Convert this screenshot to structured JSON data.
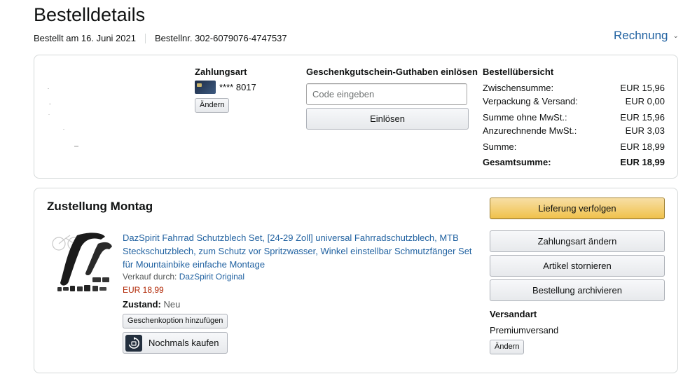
{
  "page": {
    "title": "Bestelldetails",
    "ordered_on": "Bestellt am 16. Juni 2021",
    "order_number": "Bestellnr. 302-6079076-4747537",
    "invoice_label": "Rechnung"
  },
  "payment": {
    "heading": "Zahlungsart",
    "card_masked": "**** 8017",
    "change_label": "Ändern"
  },
  "gift_card": {
    "heading": "Geschenkgutschein-Guthaben einlösen",
    "placeholder": "Code eingeben",
    "redeem_label": "Einlösen"
  },
  "summary": {
    "heading": "Bestellübersicht",
    "rows": [
      {
        "label": "Zwischensumme:",
        "value": "EUR 15,96"
      },
      {
        "label": "Verpackung & Versand:",
        "value": "EUR 0,00"
      },
      {
        "label": "Summe ohne MwSt.:",
        "value": "EUR 15,96"
      },
      {
        "label": "Anzurechnende MwSt.:",
        "value": "EUR 3,03"
      },
      {
        "label": "Summe:",
        "value": "EUR 18,99"
      },
      {
        "label": "Gesamtsumme:",
        "value": "EUR 18,99"
      }
    ]
  },
  "shipment": {
    "heading": "Zustellung Montag",
    "product_title": "DazSpirit Fahrrad Schutzblech Set, [24-29 Zoll] universal Fahrradschutzblech, MTB Steckschutzblech, zum Schutz vor Spritzwasser, Winkel einstellbar Schmutzfänger Set für Mountainbike einfache Montage",
    "sold_by_label": "Verkauf durch:",
    "seller": "DazSpirit Original",
    "price": "EUR 18,99",
    "condition_label": "Zustand:",
    "condition_value": "Neu",
    "gift_option_label": "Geschenkoption hinzufügen",
    "buy_again_label": "Nochmals kaufen"
  },
  "actions": {
    "track": "Lieferung verfolgen",
    "change_payment": "Zahlungsart ändern",
    "cancel_items": "Artikel stornieren",
    "archive_order": "Bestellung archivieren",
    "shipping_heading": "Versandart",
    "shipping_value": "Premiumversand",
    "shipping_change": "Ändern"
  },
  "colors": {
    "link": "#2162a1",
    "price": "#b12704",
    "primary_button": "#f0c14b",
    "border": "#d5d9d9"
  },
  "icons": [
    "credit-card-icon",
    "chevron-down-icon",
    "buy-again-icon",
    "product-image"
  ]
}
